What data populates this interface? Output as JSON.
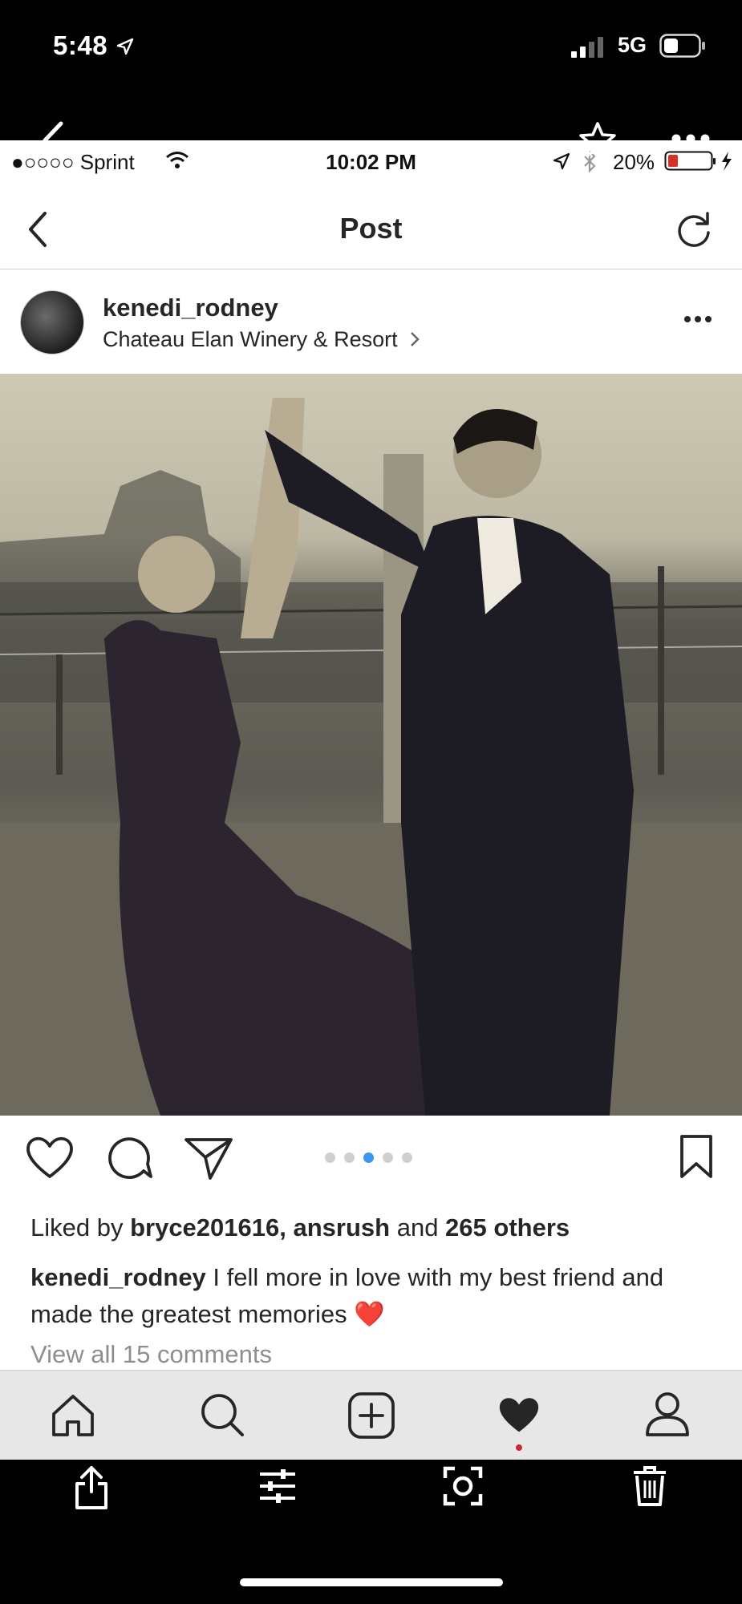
{
  "outer_status": {
    "time": "5:48",
    "network": "5G"
  },
  "inner_status": {
    "carrier": "●○○○○ Sprint",
    "time": "10:02 PM",
    "battery": "20%"
  },
  "nav": {
    "title": "Post"
  },
  "post": {
    "username": "kenedi_rodney",
    "location": "Chateau Elan Winery & Resort",
    "likes": {
      "prefix": "Liked by ",
      "user1": "bryce201616",
      "sep": ", ",
      "user2": "ansrush",
      "and": " and ",
      "others": "265 others"
    },
    "caption_user": "kenedi_rodney",
    "caption_text": " I fell more in love with my best friend and made the greatest memories ❤️",
    "comments_link": "View all 15 comments",
    "carousel": {
      "total": 5,
      "active": 3
    }
  },
  "colors": {
    "accent": "#3897f0",
    "text": "#262626",
    "muted": "#8e8e8e",
    "tab_bg": "#e7e7e7",
    "notif_dot": "#c8283c"
  },
  "icons": [
    "back-icon",
    "star-icon",
    "more-icon",
    "refresh-icon",
    "heart-icon",
    "comment-icon",
    "share-icon",
    "bookmark-icon",
    "home-icon",
    "search-icon",
    "add-icon",
    "activity-icon",
    "profile-icon",
    "upload-icon",
    "adjust-icon",
    "scan-icon",
    "trash-icon"
  ]
}
